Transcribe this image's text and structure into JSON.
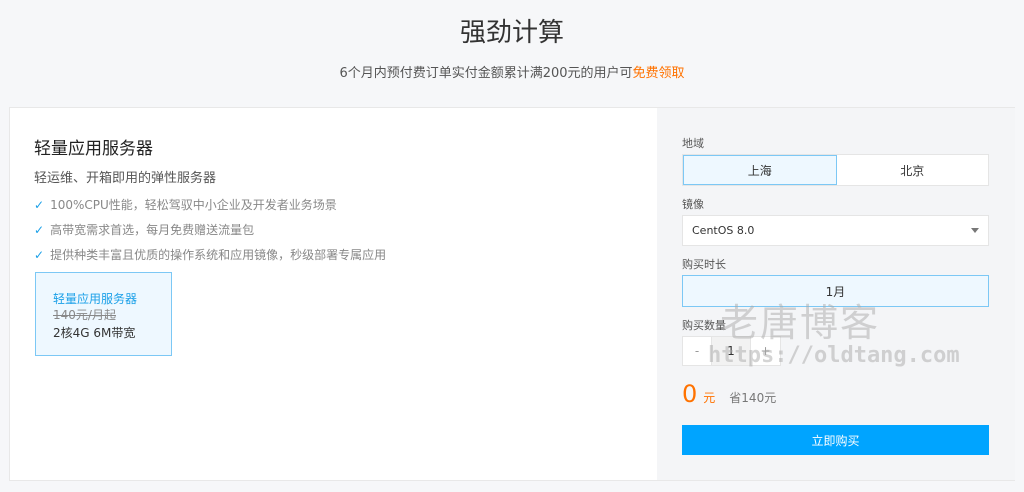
{
  "header": {
    "title": "强劲计算",
    "subtitle_prefix": "6个月内预付费订单实付金额累计满200元的用户可",
    "subtitle_highlight": "免费领取"
  },
  "product": {
    "title": "轻量应用服务器",
    "description": "轻运维、开箱即用的弹性服务器",
    "features": [
      "100%CPU性能，轻松驾驭中小企业及开发者业务场景",
      "高带宽需求首选，每月免费赠送流量包",
      "提供种类丰富且优质的操作系统和应用镜像，秒级部署专属应用"
    ],
    "plan": {
      "name": "轻量应用服务器",
      "original_price": "140元/月起",
      "spec": "2核4G 6M带宽"
    }
  },
  "order": {
    "region_label": "地域",
    "regions": [
      "上海",
      "北京"
    ],
    "selected_region": "上海",
    "image_label": "镜像",
    "image_value": "CentOS 8.0",
    "duration_label": "购买时长",
    "duration_value": "1月",
    "quantity_label": "购买数量",
    "minus": "-",
    "quantity": "1",
    "plus": "+",
    "price": "0",
    "currency": "元",
    "savings": "省140元",
    "buy_label": "立即购买"
  },
  "watermark": {
    "line1": "老唐博客",
    "line2": "https://oldtang.com"
  },
  "colors": {
    "accent": "#00a4ff",
    "highlight": "#ff7200"
  }
}
